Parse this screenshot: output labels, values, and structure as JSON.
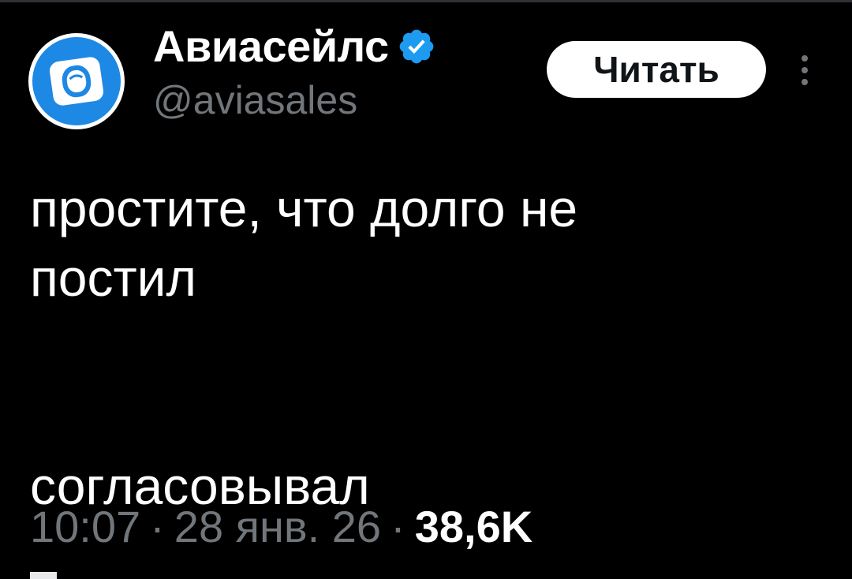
{
  "account": {
    "display_name": "Авиасейлс",
    "handle": "@aviasales",
    "verified_icon": "verified-badge-icon",
    "avatar_icon": "aviasales-logo-icon",
    "verified_color": "#1d9bf0",
    "avatar_color": "#1e88e5"
  },
  "actions": {
    "follow_label": "Читать",
    "more_icon": "more-vertical-icon"
  },
  "tweet": {
    "text": "простите, что долго не\nпостил\n\n\nсогласовывал",
    "time": "10:07",
    "separator": "·",
    "date": "28 янв. 26",
    "views": "38,6K"
  },
  "colors": {
    "background": "#000000",
    "text_primary": "#ffffff",
    "text_secondary": "#71767b",
    "button_bg": "#ffffff",
    "button_text": "#0f1419"
  }
}
